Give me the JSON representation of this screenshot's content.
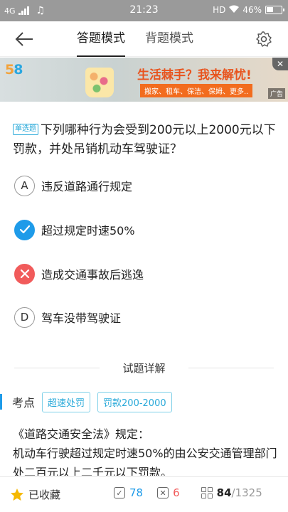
{
  "status_bar": {
    "network": "4G",
    "time": "21:23",
    "hd": "HD",
    "battery": "46%"
  },
  "nav": {
    "tabs": [
      {
        "label": "答题模式",
        "active": true
      },
      {
        "label": "背题模式",
        "active": false
      }
    ]
  },
  "ad": {
    "logo": "58",
    "slogan": "生活棘手？我来解忧!",
    "services": "搬家、租车、保洁、保姆、更多..",
    "tag": "广告",
    "close": "✕"
  },
  "question": {
    "type": "单选题",
    "text": "下列哪种行为会受到200元以上2000元以下罚款，并处吊销机动车驾驶证？"
  },
  "options": [
    {
      "letter": "A",
      "text": "违反道路通行规定",
      "state": "normal"
    },
    {
      "letter": "B",
      "text": "超过规定时速50%",
      "state": "correct"
    },
    {
      "letter": "C",
      "text": "造成交通事故后逃逸",
      "state": "wrong"
    },
    {
      "letter": "D",
      "text": "驾车没带驾驶证",
      "state": "normal"
    }
  ],
  "analysis": {
    "title": "试题详解",
    "kp_label": "考点",
    "tags": [
      "超速处罚",
      "罚款200-2000"
    ],
    "explanation": "《道路交通安全法》规定：\n机动车行驶超过规定时速50%的由公安交通管理部门处二百元以上二千元以下罚款。"
  },
  "bottom": {
    "favorite_label": "已收藏",
    "correct_count": "78",
    "wrong_count": "6",
    "current": "84",
    "total": "/1325"
  },
  "colors": {
    "accent": "#1e9be9",
    "wrong": "#f15b5b",
    "star": "#f5b800"
  }
}
